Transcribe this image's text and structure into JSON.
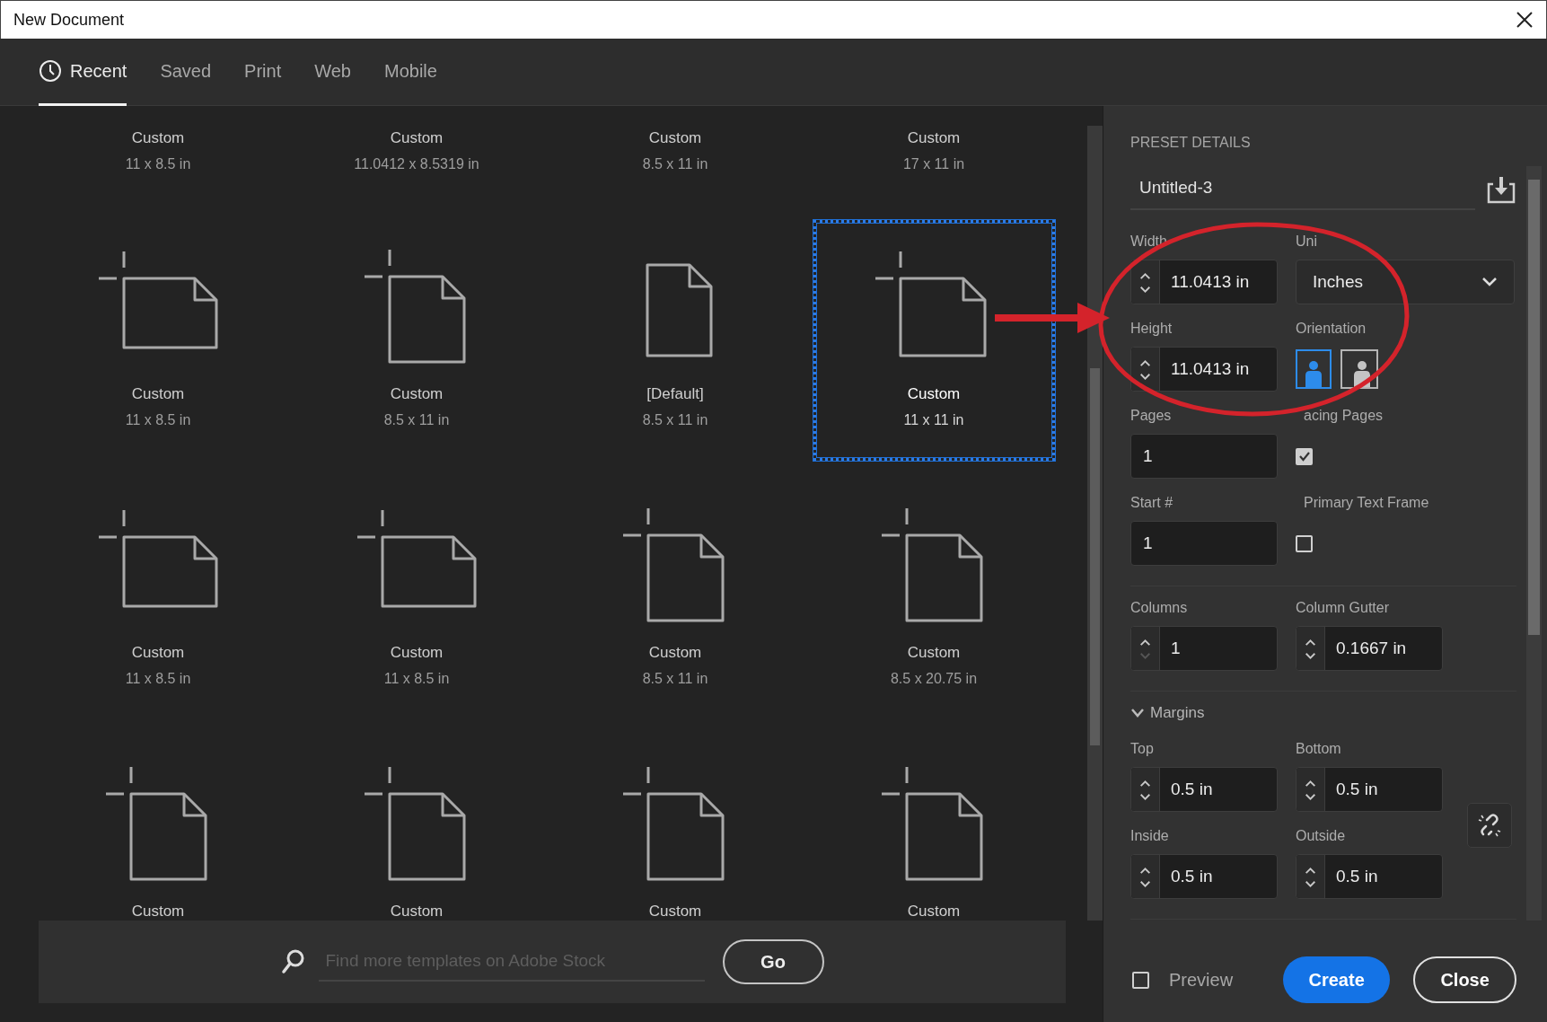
{
  "window": {
    "title": "New Document"
  },
  "tabs": [
    {
      "label": "Recent",
      "selected": true,
      "icon": true
    },
    {
      "label": "Saved",
      "selected": false
    },
    {
      "label": "Print",
      "selected": false
    },
    {
      "label": "Web",
      "selected": false
    },
    {
      "label": "Mobile",
      "selected": false
    }
  ],
  "presets": [
    {
      "name": "Custom",
      "size": "11 x 8.5 in",
      "kind": "clipped",
      "selected": false
    },
    {
      "name": "Custom",
      "size": "11.0412 x 8.5319 in",
      "kind": "clipped",
      "selected": false
    },
    {
      "name": "Custom",
      "size": "8.5 x 11 in",
      "kind": "clipped",
      "selected": false
    },
    {
      "name": "Custom",
      "size": "17 x 11 in",
      "kind": "clipped",
      "selected": false
    },
    {
      "name": "Custom",
      "size": "11 x 8.5 in",
      "kind": "landscape",
      "selected": false
    },
    {
      "name": "Custom",
      "size": "8.5 x 11 in",
      "kind": "portrait",
      "selected": false
    },
    {
      "name": "[Default]",
      "size": "8.5 x 11 in",
      "kind": "plain",
      "selected": false
    },
    {
      "name": "Custom",
      "size": "11 x 11 in",
      "kind": "square",
      "selected": true
    },
    {
      "name": "Custom",
      "size": "11 x 8.5 in",
      "kind": "landscape",
      "selected": false
    },
    {
      "name": "Custom",
      "size": "11 x 8.5 in",
      "kind": "landscape",
      "selected": false
    },
    {
      "name": "Custom",
      "size": "8.5 x 11 in",
      "kind": "portrait",
      "selected": false
    },
    {
      "name": "Custom",
      "size": "8.5 x 20.75 in",
      "kind": "portrait",
      "selected": false
    },
    {
      "name": "Custom",
      "kind": "portrait",
      "selected": false
    },
    {
      "name": "Custom",
      "kind": "portrait",
      "selected": false
    },
    {
      "name": "Custom",
      "kind": "portrait",
      "selected": false
    },
    {
      "name": "Custom",
      "kind": "portrait",
      "selected": false
    }
  ],
  "search": {
    "placeholder": "Find more templates on Adobe Stock",
    "button": "Go"
  },
  "details": {
    "heading": "PRESET DETAILS",
    "name": "Untitled-3",
    "sections": [
      {
        "rows": [
          [
            {
              "kind": "spin",
              "label": "Width",
              "value": "11.0413 in"
            },
            {
              "kind": "select",
              "label": "Uni",
              "value": "Inches"
            }
          ],
          [
            {
              "kind": "spin",
              "label": "Height",
              "value": "11.0413 in"
            },
            {
              "kind": "orientation",
              "label": "Orientation",
              "options": [
                {
                  "kind": "portrait",
                  "selected": true
                },
                {
                  "kind": "landscape",
                  "selected": false
                }
              ]
            }
          ],
          [
            {
              "kind": "plain",
              "label": "Pages",
              "value": "1"
            },
            {
              "kind": "check",
              "label": "acing Pages",
              "checked": true
            }
          ],
          [
            {
              "kind": "plain",
              "label": "Start #",
              "value": "1"
            },
            {
              "kind": "check",
              "label": "Primary Text Frame",
              "checked": false
            }
          ]
        ]
      },
      {
        "rows": [
          [
            {
              "kind": "spin",
              "label": "Columns",
              "value": "1",
              "down_disabled": true
            },
            {
              "kind": "spin",
              "label": "Column Gutter",
              "value": "0.1667 in"
            }
          ]
        ]
      },
      {
        "title": "Margins",
        "expanded": true,
        "link": true,
        "rows": [
          [
            {
              "kind": "spin",
              "label": "Top",
              "value": "0.5 in"
            },
            {
              "kind": "spin",
              "label": "Bottom",
              "value": "0.5 in"
            }
          ],
          [
            {
              "kind": "spin",
              "label": "Inside",
              "value": "0.5 in"
            },
            {
              "kind": "spin",
              "label": "Outside",
              "value": "0.5 in"
            }
          ]
        ]
      }
    ]
  },
  "footer": {
    "preview": {
      "label": "Preview",
      "checked": false
    },
    "buttons": [
      {
        "label": "Create",
        "kind": "primary"
      },
      {
        "label": "Close",
        "kind": "secondary"
      }
    ]
  },
  "annotations": {
    "ellipse": true,
    "arrow": true
  }
}
